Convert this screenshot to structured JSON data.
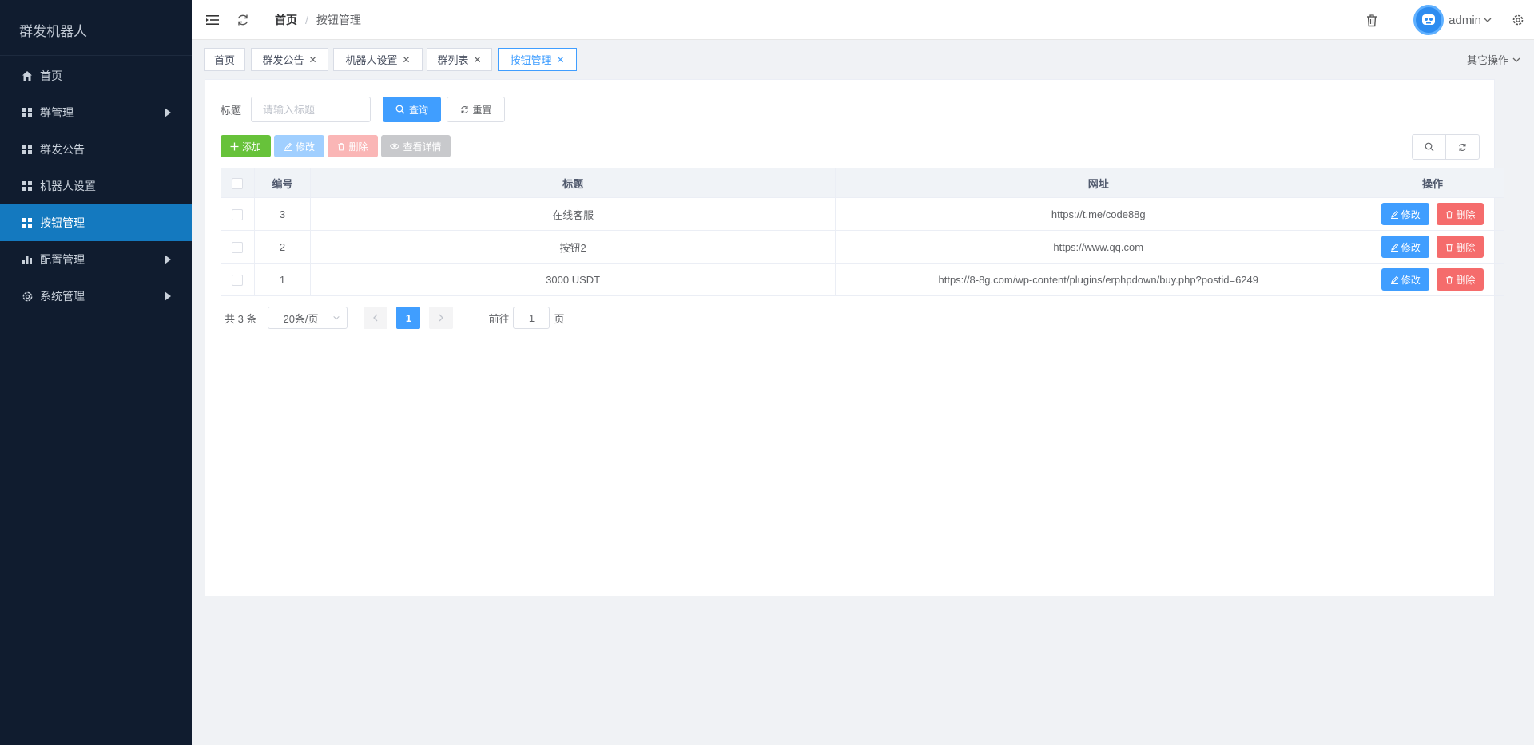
{
  "sidebar": {
    "title": "群发机器人",
    "items": [
      {
        "label": "首页"
      },
      {
        "label": "群管理"
      },
      {
        "label": "群发公告"
      },
      {
        "label": "机器人设置"
      },
      {
        "label": "按钮管理"
      },
      {
        "label": "配置管理"
      },
      {
        "label": "系统管理"
      }
    ]
  },
  "navbar": {
    "breadcrumb_home": "首页",
    "breadcrumb_sep": "/",
    "breadcrumb_current": "按钮管理",
    "username": "admin"
  },
  "tags": {
    "items": [
      {
        "label": "首页"
      },
      {
        "label": "群发公告"
      },
      {
        "label": "机器人设置"
      },
      {
        "label": "群列表"
      },
      {
        "label": "按钮管理"
      }
    ],
    "other_ops": "其它操作"
  },
  "search": {
    "label": "标题",
    "placeholder": "请输入标题",
    "query_label": "查询",
    "reset_label": "重置"
  },
  "toolbar": {
    "add_label": "添加",
    "edit_label": "修改",
    "delete_label": "删除",
    "detail_label": "查看详情"
  },
  "table": {
    "headers": {
      "id": "编号",
      "title": "标题",
      "url": "网址",
      "ops": "操作"
    },
    "edit_label": "修改",
    "delete_label": "删除",
    "rows": [
      {
        "id": "3",
        "title": "在线客服",
        "url": "https://t.me/code88g"
      },
      {
        "id": "2",
        "title": "按钮2",
        "url": "https://www.qq.com"
      },
      {
        "id": "1",
        "title": "3000 USDT",
        "url": "https://8-8g.com/wp-content/plugins/erphpdown/buy.php?postid=6249"
      }
    ]
  },
  "pagination": {
    "total": "共 3 条",
    "page_size": "20条/页",
    "current_page": "1",
    "goto_prefix": "前往",
    "goto_value": "1",
    "goto_suffix": "页"
  },
  "colors": {
    "sidebar_bg": "#101c2f",
    "sidebar_active": "#1479bf",
    "primary": "#409eff",
    "success": "#67c23a",
    "danger": "#f56c6c"
  }
}
